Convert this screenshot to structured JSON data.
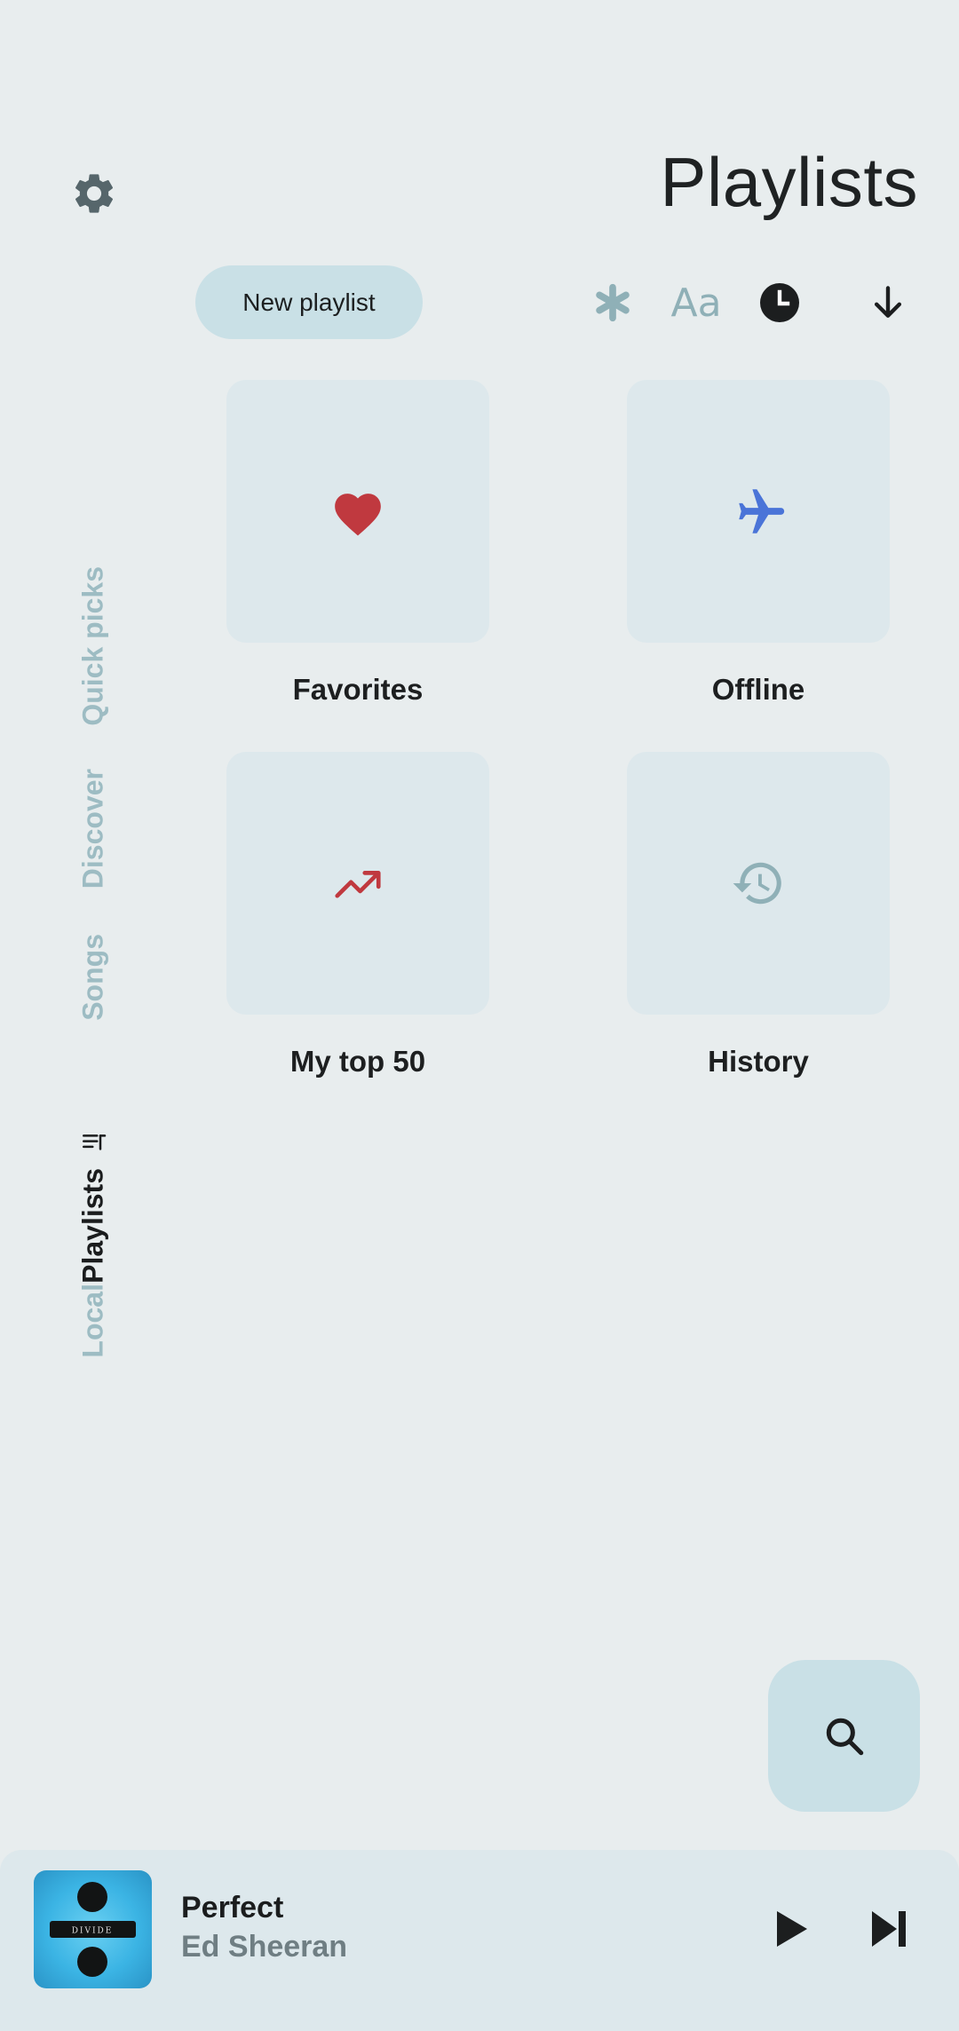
{
  "header": {
    "title": "Playlists"
  },
  "toolbar": {
    "new_playlist_label": "New playlist",
    "font_label": "Aa"
  },
  "sidebar": {
    "items": [
      {
        "label": "Quick picks",
        "active": false
      },
      {
        "label": "Discover",
        "active": false
      },
      {
        "label": "Songs",
        "active": false
      },
      {
        "label": "Playlists",
        "active": true
      },
      {
        "label": "Local",
        "active": false
      }
    ]
  },
  "playlists": [
    {
      "label": "Favorites",
      "icon": "heart-icon",
      "color": "#c0393f"
    },
    {
      "label": "Offline",
      "icon": "airplane-icon",
      "color": "#4a74d8"
    },
    {
      "label": "My top 50",
      "icon": "trending-up-icon",
      "color": "#c0393f"
    },
    {
      "label": "History",
      "icon": "history-icon",
      "color": "#8fb0b7"
    }
  ],
  "player": {
    "title": "Perfect",
    "artist": "Ed Sheeran",
    "cover_text": "DIVIDE"
  },
  "colors": {
    "background": "#e8edee",
    "accent_container": "#c9e0e6",
    "muted": "#9dbcc3"
  }
}
